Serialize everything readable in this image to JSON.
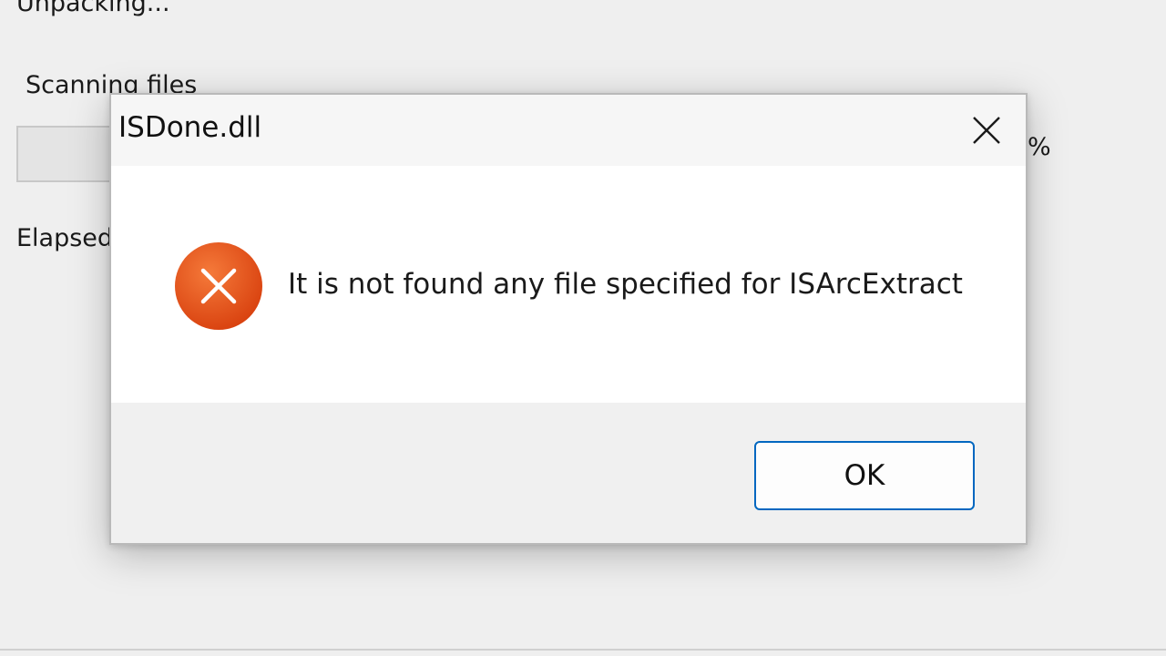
{
  "installer": {
    "status_text": "Unpacking...",
    "scan_label": "Scanning files",
    "percent_text": "%",
    "elapsed_label": "Elapsed",
    "progress": 0
  },
  "dialog": {
    "title": "ISDone.dll",
    "message": "It is not found any file specified for ISArcExtract",
    "ok_label": "OK",
    "icon": "error-icon",
    "close_icon": "close-icon"
  },
  "colors": {
    "error_icon": "#e8501a",
    "button_border": "#0067c0"
  }
}
